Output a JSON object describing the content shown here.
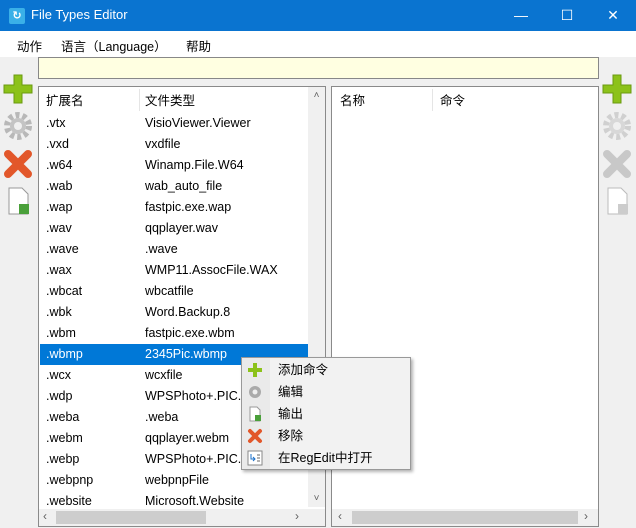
{
  "window": {
    "title": "File Types Editor",
    "minimize": "—",
    "maximize": "☐",
    "close": "✕"
  },
  "menu": [
    "动作",
    "语言（Language）",
    "帮助"
  ],
  "address": {
    "value": ""
  },
  "left_table": {
    "columns": [
      "扩展名",
      "文件类型"
    ],
    "rows": [
      [
        ".vtx",
        "VisioViewer.Viewer"
      ],
      [
        ".vxd",
        "vxdfile"
      ],
      [
        ".w64",
        "Winamp.File.W64"
      ],
      [
        ".wab",
        "wab_auto_file"
      ],
      [
        ".wap",
        "fastpic.exe.wap"
      ],
      [
        ".wav",
        "qqplayer.wav"
      ],
      [
        ".wave",
        ".wave"
      ],
      [
        ".wax",
        "WMP11.AssocFile.WAX"
      ],
      [
        ".wbcat",
        "wbcatfile"
      ],
      [
        ".wbk",
        "Word.Backup.8"
      ],
      [
        ".wbm",
        "fastpic.exe.wbm"
      ],
      [
        ".wbmp",
        "2345Pic.wbmp"
      ],
      [
        ".wcx",
        "wcxfile"
      ],
      [
        ".wdp",
        "WPSPhoto+.PIC.wdp"
      ],
      [
        ".weba",
        ".weba"
      ],
      [
        ".webm",
        "qqplayer.webm"
      ],
      [
        ".webp",
        "WPSPhoto+.PIC.webp"
      ],
      [
        ".webpnp",
        "webpnpFile"
      ],
      [
        ".website",
        "Microsoft.Website"
      ]
    ],
    "selected_index": 11
  },
  "right_table": {
    "columns": [
      "名称",
      "命令"
    ]
  },
  "context_menu": [
    "添加命令",
    "编辑",
    "输出",
    "移除",
    "在RegEdit中打开"
  ],
  "scroll": {
    "up": "˄",
    "down": "˅",
    "left": "‹",
    "right": "›"
  }
}
